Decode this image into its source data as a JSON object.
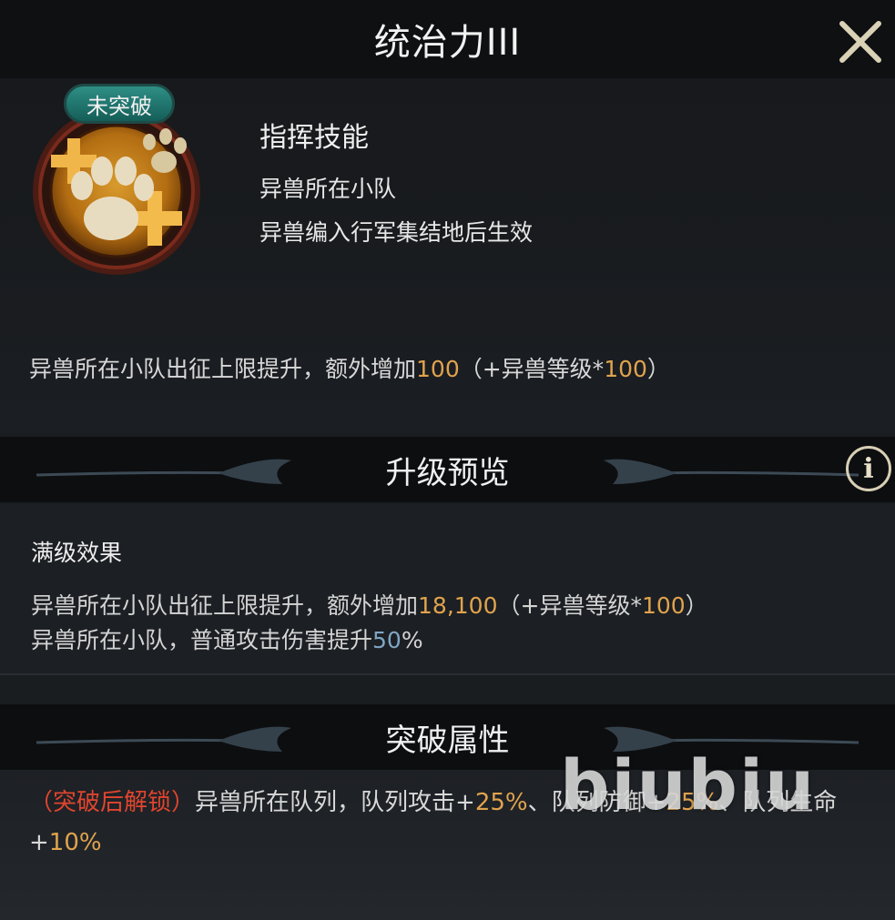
{
  "window": {
    "title": "统治力III",
    "close_icon": "close-icon"
  },
  "skill": {
    "status_badge": "未突破",
    "icon": "beast-paw-icon",
    "type": "指挥技能",
    "scope": "异兽所在小队",
    "condition": "异兽编入行军集结地后生效",
    "current_effect": {
      "prefix": "异兽所在小队出征上限提升，额外增加",
      "value": "100",
      "suffix_open": "（+异兽等级*",
      "suffix_value": "100",
      "suffix_close": "）"
    }
  },
  "upgrade_preview": {
    "title": "升级预览",
    "info_icon": "info-icon",
    "max_label": "满级效果",
    "line1": {
      "prefix": "异兽所在小队出征上限提升，额外增加",
      "value": "18,100",
      "suffix_open": "（+异兽等级*",
      "suffix_value": "100",
      "suffix_close": "）"
    },
    "line2": {
      "prefix": "异兽所在小队，普通攻击伤害提升",
      "value": "50",
      "suffix": "%"
    }
  },
  "breakthrough": {
    "title": "突破属性",
    "locked_label": "（突破后解锁）",
    "text1": "异兽所在队列，队列攻击+",
    "atk": "25%",
    "text2": "、队列防御+",
    "def": "25%",
    "text3": "、队列生命+",
    "hp": "10%"
  },
  "watermark": "biubiu",
  "colors": {
    "highlight_orange": "#e0a34e",
    "highlight_blue": "#7fa6c4",
    "locked_red": "#e0452f",
    "badge_teal": "#2e8f86"
  }
}
